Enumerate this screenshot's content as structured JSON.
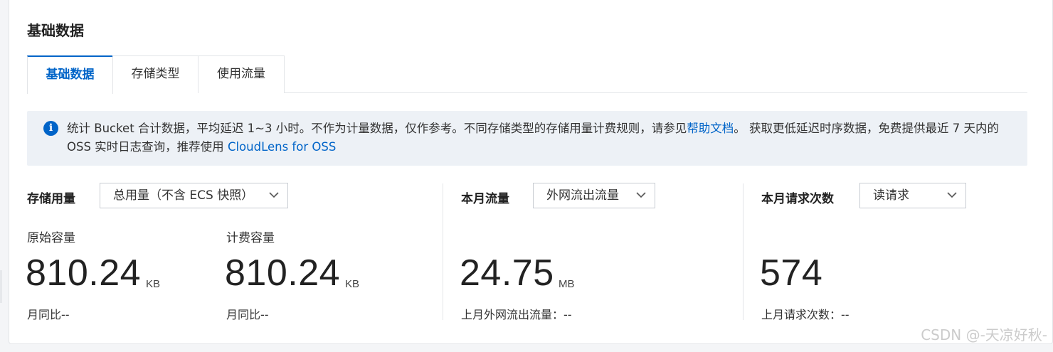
{
  "section": {
    "title": "基础数据"
  },
  "tabs": [
    {
      "label": "基础数据",
      "active": true
    },
    {
      "label": "存储类型",
      "active": false
    },
    {
      "label": "使用流量",
      "active": false
    }
  ],
  "notice": {
    "icon": "info-icon",
    "text_before_link": "统计 Bucket 合计数据，平均延迟 1~3 小时。不作为计量数据，仅作参考。不同存储类型的存储用量计费规则，请参见",
    "help_link": "帮助文档",
    "text_middle": "。 获取更低延迟时序数据，免费提供最近 7 天内的 OSS 实时日志查询，推荐使用 ",
    "cloudlens_link": "CloudLens for OSS"
  },
  "storage": {
    "label": "存储用量",
    "select_value": "总用量（不含 ECS 快照）",
    "original": {
      "label": "原始容量",
      "value": "810.24",
      "unit": "KB",
      "compare": "月同比--"
    },
    "billed": {
      "label": "计费容量",
      "value": "810.24",
      "unit": "KB",
      "compare": "月同比--"
    }
  },
  "traffic": {
    "label": "本月流量",
    "select_value": "外网流出流量",
    "value": "24.75",
    "unit": "MB",
    "compare": "上月外网流出流量：--"
  },
  "requests": {
    "label": "本月请求次数",
    "select_value": "读请求",
    "value": "574",
    "compare": "上月请求次数：--"
  },
  "watermark": "CSDN @-天凉好秋-",
  "colors": {
    "accent": "#0064c8",
    "notice_bg": "#edf1f6"
  }
}
